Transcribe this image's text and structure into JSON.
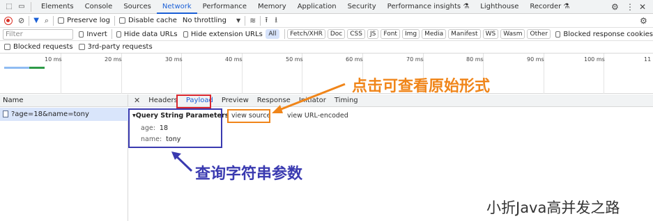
{
  "tabs": [
    "Elements",
    "Console",
    "Sources",
    "Network",
    "Performance",
    "Memory",
    "Application",
    "Security",
    "Performance insights",
    "Lighthouse",
    "Recorder"
  ],
  "toolbar1": {
    "preserve_log": "Preserve log",
    "disable_cache": "Disable cache",
    "throttling": "No throttling"
  },
  "toolbar2": {
    "filter_placeholder": "Filter",
    "invert": "Invert",
    "hide_data_urls": "Hide data URLs",
    "hide_extension_urls": "Hide extension URLs",
    "types": [
      "All",
      "Fetch/XHR",
      "Doc",
      "CSS",
      "JS",
      "Font",
      "Img",
      "Media",
      "Manifest",
      "WS",
      "Wasm",
      "Other"
    ],
    "blocked_response_cookies": "Blocked response cookies"
  },
  "toolbar3": {
    "blocked_requests": "Blocked requests",
    "third_party": "3rd-party requests"
  },
  "timeline": {
    "ticks": [
      "10 ms",
      "20 ms",
      "30 ms",
      "40 ms",
      "50 ms",
      "60 ms",
      "70 ms",
      "80 ms",
      "90 ms",
      "100 ms",
      "11"
    ]
  },
  "requests": {
    "header": "Name",
    "rows": [
      "?age=18&name=tony"
    ]
  },
  "detail": {
    "tabs": [
      "Headers",
      "Payload",
      "Preview",
      "Response",
      "Initiator",
      "Timing"
    ],
    "section_title": "Query String Parameters",
    "view_source": "view source",
    "view_url_encoded": "view URL-encoded",
    "params": [
      {
        "key": "age:",
        "value": "18"
      },
      {
        "key": "name:",
        "value": "tony"
      }
    ]
  },
  "annotations": {
    "top_text": "点击可查看原始形式",
    "bottom_text": "查询字符串参数",
    "watermark": "小折Java高并发之路",
    "colors": {
      "red": "#d9262e",
      "orange": "#f08519",
      "blue": "#3a3ab0"
    }
  }
}
